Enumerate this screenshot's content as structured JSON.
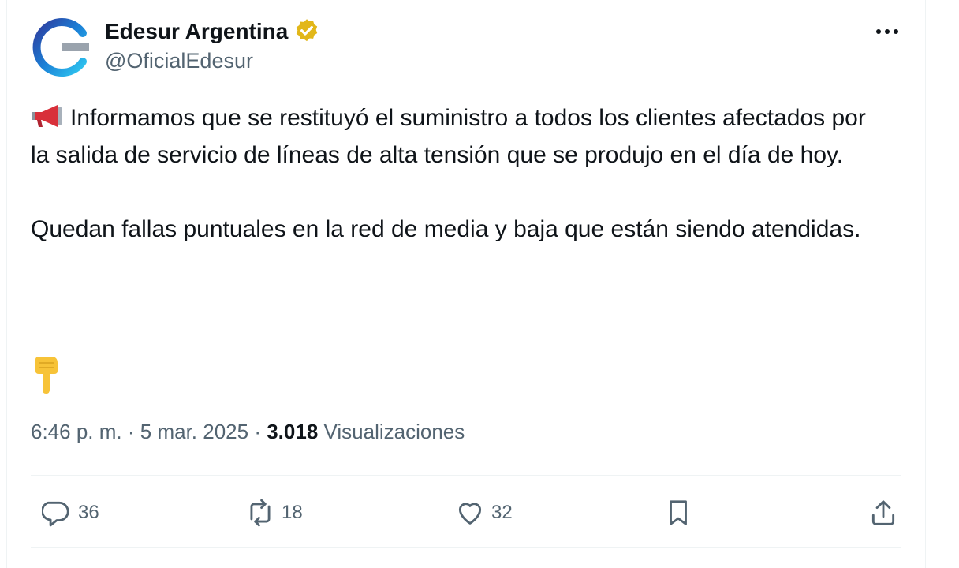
{
  "author": {
    "display_name": "Edesur Argentina",
    "handle": "@OficialEdesur",
    "verified": true,
    "avatar_icon": "edesur-logo-icon",
    "verified_icon": "verified-badge-icon"
  },
  "more_icon": "more-options-icon",
  "tweet": {
    "paragraph1": "Informamos que se restituyó el suministro a todos los clientes afectados por la salida de servicio de líneas de alta tensión que se produjo en el día de hoy.",
    "paragraph2": "Quedan fallas puntuales en la red de media y baja que están siendo atendidas.",
    "emoji_leading": "megaphone-icon",
    "emoji_trailing": "pointing-down-icon"
  },
  "meta": {
    "time": "6:46 p. m.",
    "separator": "·",
    "date": "5 mar. 2025",
    "views_count": "3.018",
    "views_label": "Visualizaciones"
  },
  "actions": {
    "replies": "36",
    "reposts": "18",
    "likes": "32"
  },
  "colors": {
    "text_primary": "#0f1419",
    "text_secondary": "#536471",
    "divider": "#eff3f4",
    "verified_badge": "#e2b719",
    "brand_blue": "#00a3e0"
  }
}
